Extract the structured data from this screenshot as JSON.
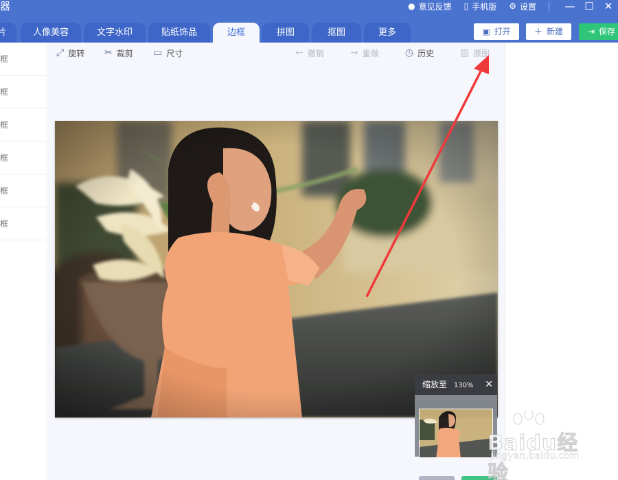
{
  "app": {
    "title_fragment": "器"
  },
  "top_links": {
    "feedback": "意见反馈",
    "mobile": "手机版",
    "settings": "设置"
  },
  "tabs": [
    {
      "label": "片"
    },
    {
      "label": "人像美容"
    },
    {
      "label": "文字水印"
    },
    {
      "label": "贴纸饰品"
    },
    {
      "label": "边框",
      "active": true
    },
    {
      "label": "拼图"
    },
    {
      "label": "抠图"
    },
    {
      "label": "更多"
    }
  ],
  "actions": {
    "open": "打开",
    "new": "新建",
    "save": "保存"
  },
  "sidebar": {
    "items": [
      "框",
      "框",
      "框",
      "框",
      "框",
      "框"
    ]
  },
  "toolbar": {
    "rotate": "旋转",
    "crop": "裁剪",
    "size": "尺寸",
    "undo": "撤销",
    "redo": "重做",
    "history": "历史",
    "original": "原图"
  },
  "zoom": {
    "label": "缩放至",
    "value": "130%"
  },
  "watermark": {
    "brand": "Baidu经验",
    "url": "jingyan.baidu.com"
  },
  "colors": {
    "header_blue": "#4a73d0",
    "tab_blue": "#3d66c8",
    "active_tab_text": "#3a6ad2",
    "canvas_bg": "#f5f7fc",
    "save_green": "#2fc67a",
    "annotation_red": "#f0393a"
  }
}
